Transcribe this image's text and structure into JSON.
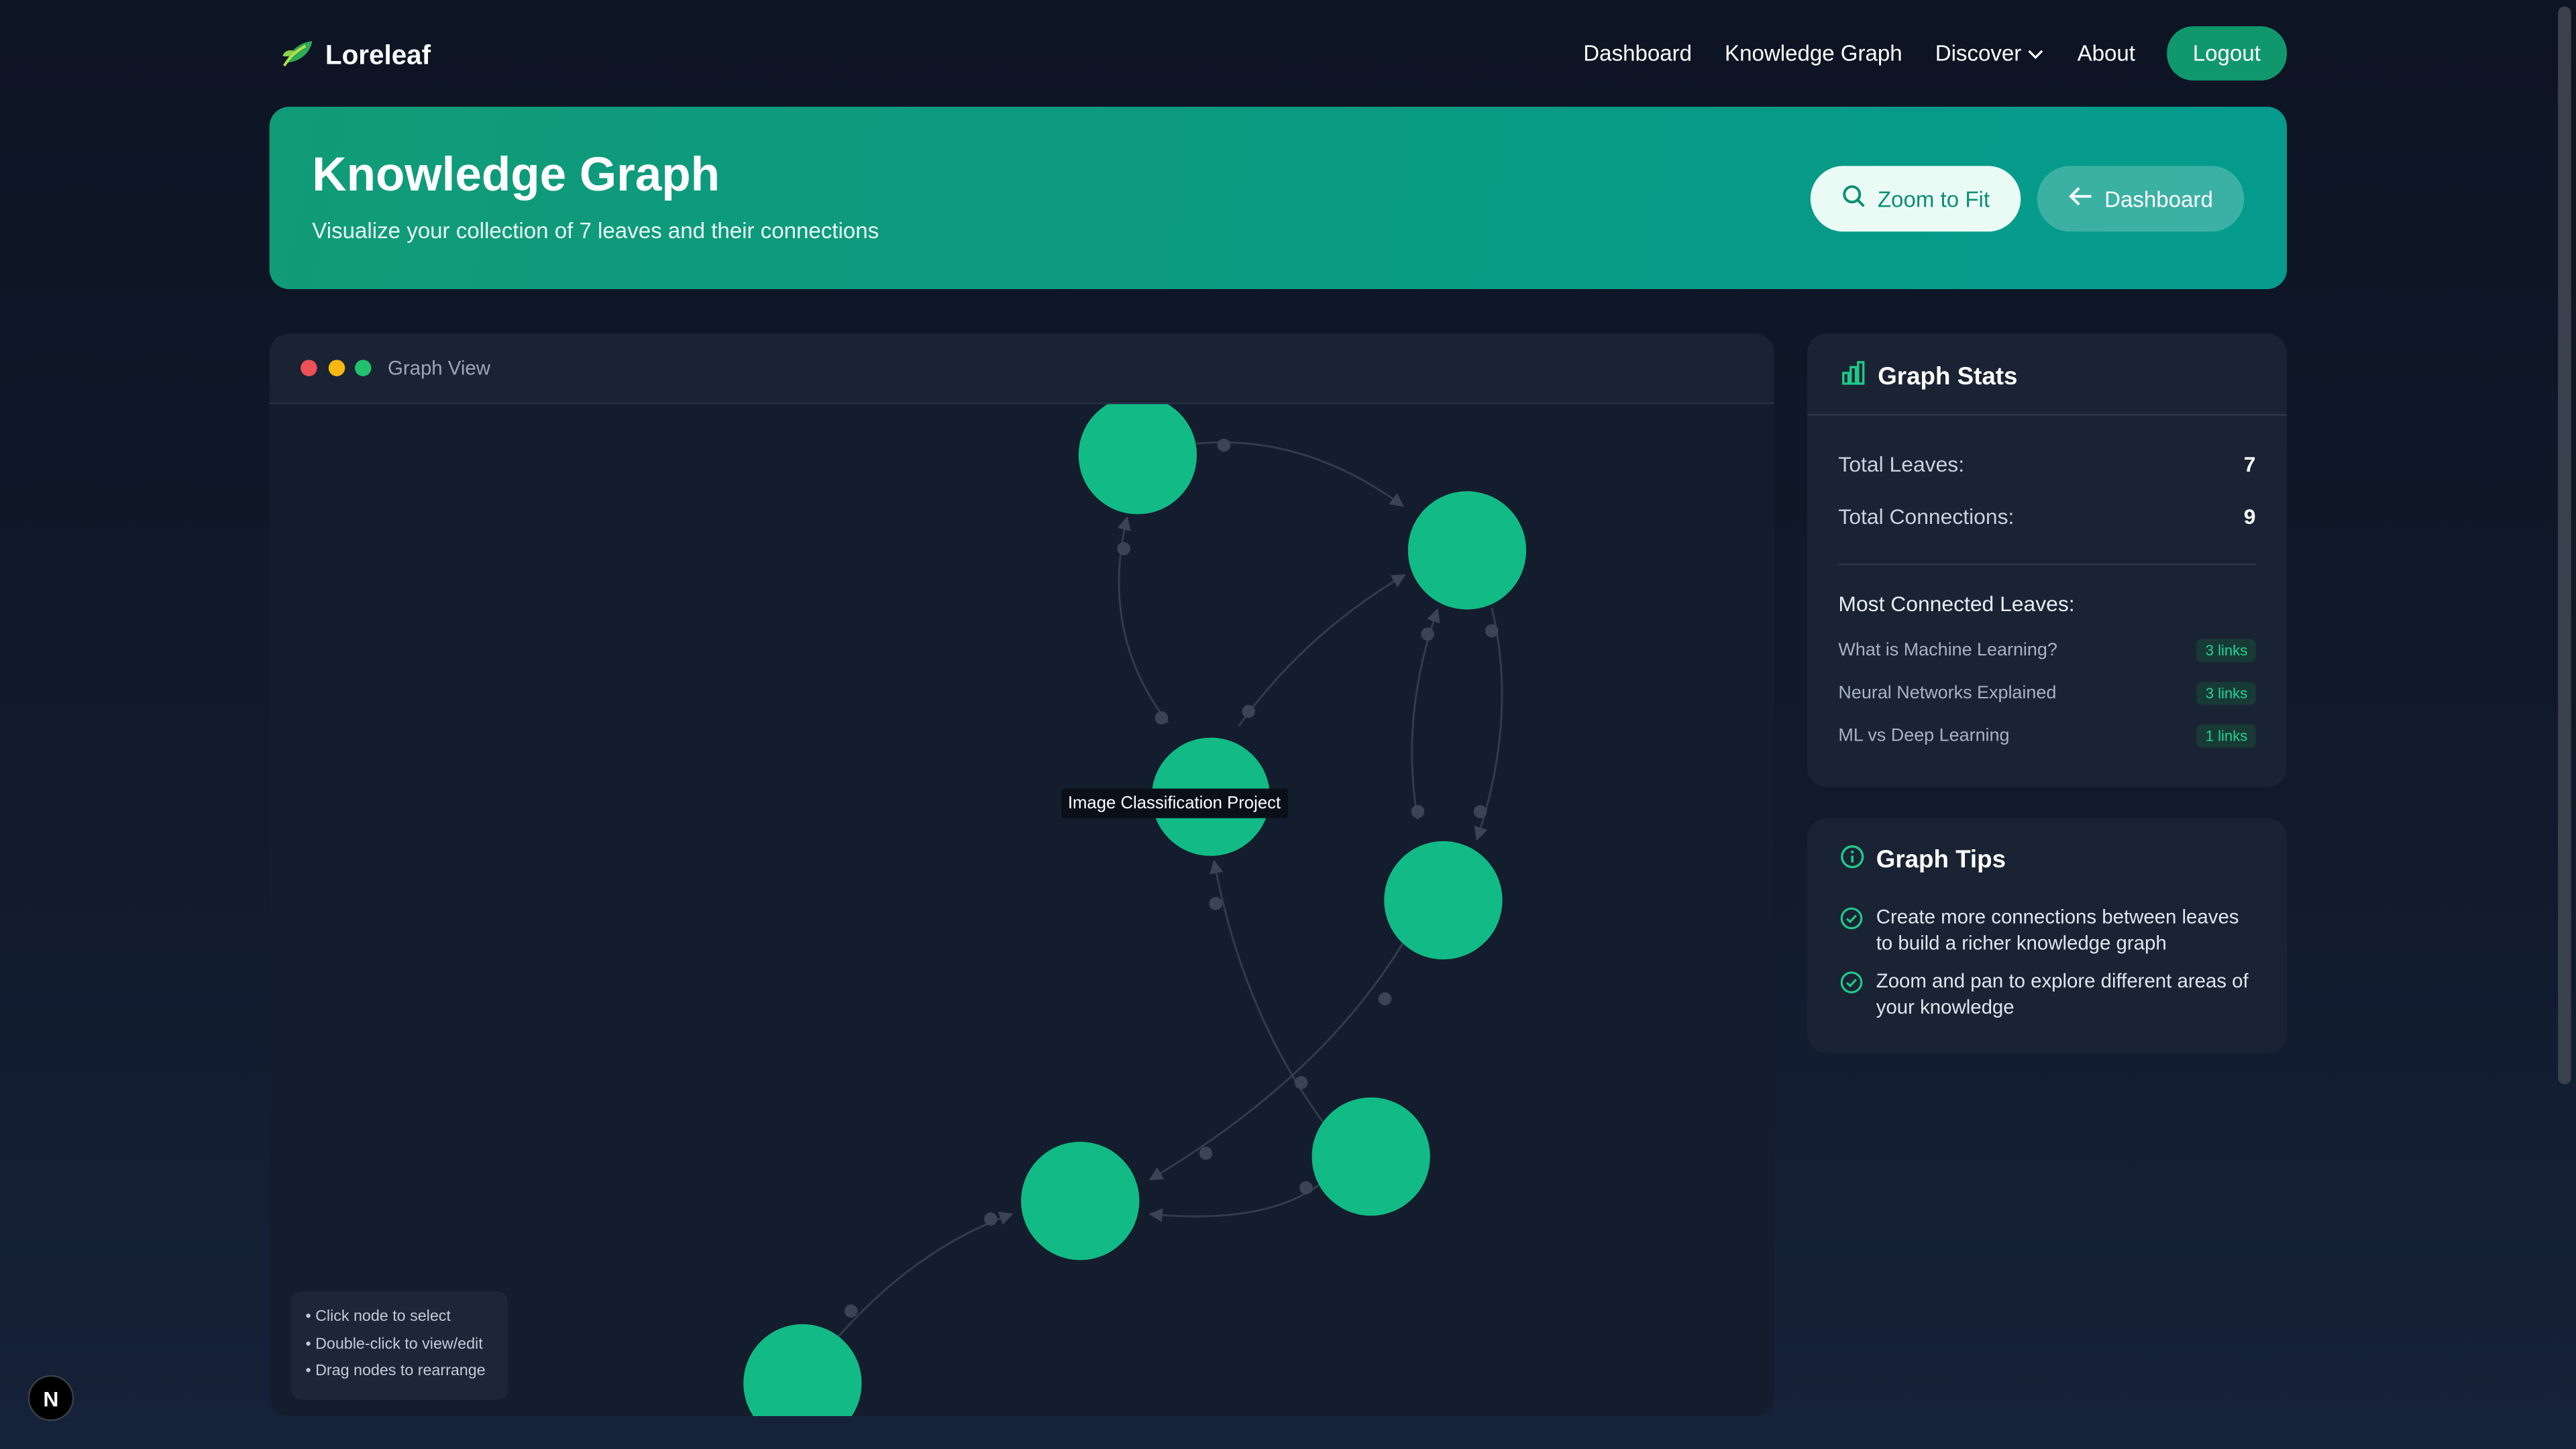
{
  "nav": {
    "brand": "Loreleaf",
    "links": [
      "Dashboard",
      "Knowledge Graph",
      "Discover",
      "About"
    ],
    "logout": "Logout"
  },
  "hero": {
    "title": "Knowledge Graph",
    "subtitle": "Visualize your collection of 7 leaves and their connections",
    "zoom_button": "Zoom to Fit",
    "dashboard_button": "Dashboard"
  },
  "graph": {
    "window_title": "Graph View",
    "hovered_node_label": "Image Classification Project",
    "help": [
      "• Click node to select",
      "• Double-click to view/edit",
      "• Drag nodes to rearrange"
    ],
    "node_color": "#12bb85",
    "edge_color": "#3a4456"
  },
  "stats": {
    "title": "Graph Stats",
    "total_leaves_label": "Total Leaves:",
    "total_leaves": "7",
    "total_connections_label": "Total Connections:",
    "total_connections": "9",
    "most_connected_title": "Most Connected Leaves:",
    "most_connected": [
      {
        "name": "What is Machine Learning?",
        "links": "3 links"
      },
      {
        "name": "Neural Networks Explained",
        "links": "3 links"
      },
      {
        "name": "ML vs Deep Learning",
        "links": "1 links"
      }
    ]
  },
  "tips": {
    "title": "Graph Tips",
    "items": [
      "Create more connections between leaves to build a richer knowledge graph",
      "Zoom and pan to explore different areas of your knowledge"
    ]
  },
  "colors": {
    "accent": "#10986c",
    "hero_start": "#119b78",
    "hero_end": "#049b8d",
    "node": "#12bb85"
  },
  "framework_badge": "N"
}
